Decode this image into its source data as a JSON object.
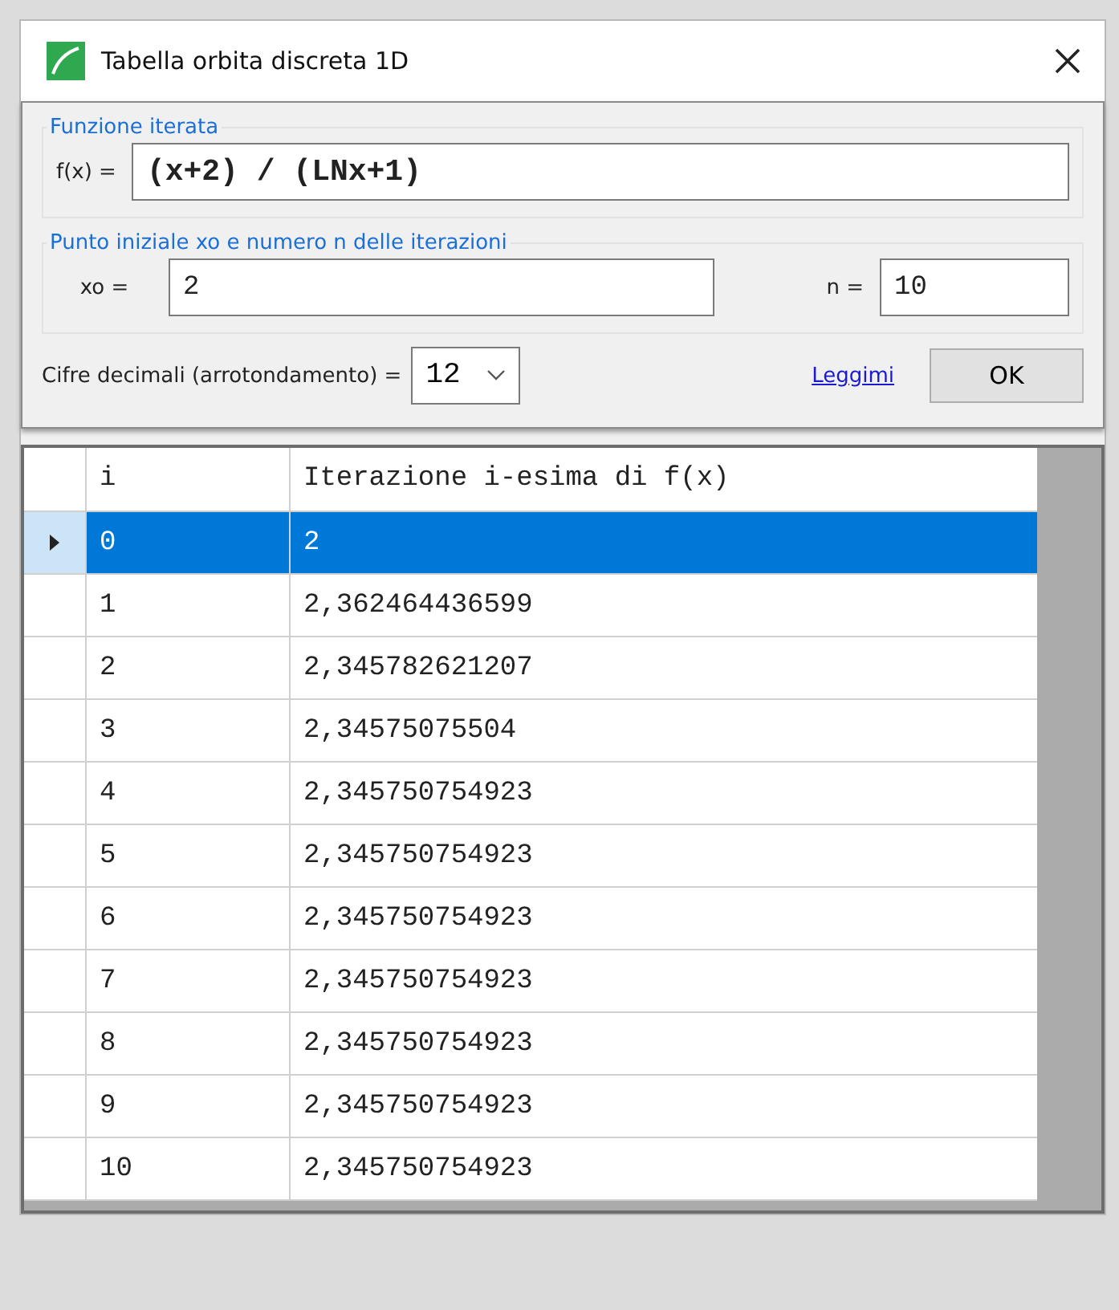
{
  "window": {
    "title": "Tabella orbita discreta 1D"
  },
  "function_group": {
    "legend": "Funzione iterata",
    "label": "f(x) =",
    "value": "(x+2) / (LNx+1)"
  },
  "start_group": {
    "legend": "Punto iniziale xo e numero n delle iterazioni",
    "xo_label": "xo =",
    "xo_value": "2",
    "n_label": "n =",
    "n_value": "10"
  },
  "decimals": {
    "label": "Cifre decimali (arrotondamento) =",
    "value": "12"
  },
  "readme_link": "Leggimi",
  "ok_button": "OK",
  "table": {
    "columns": [
      "i",
      "Iterazione i-esima di f(x)"
    ],
    "rows": [
      {
        "i": "0",
        "value": "2",
        "selected": true
      },
      {
        "i": "1",
        "value": "2,362464436599",
        "selected": false
      },
      {
        "i": "2",
        "value": "2,345782621207",
        "selected": false
      },
      {
        "i": "3",
        "value": "2,34575075504",
        "selected": false
      },
      {
        "i": "4",
        "value": "2,345750754923",
        "selected": false
      },
      {
        "i": "5",
        "value": "2,345750754923",
        "selected": false
      },
      {
        "i": "6",
        "value": "2,345750754923",
        "selected": false
      },
      {
        "i": "7",
        "value": "2,345750754923",
        "selected": false
      },
      {
        "i": "8",
        "value": "2,345750754923",
        "selected": false
      },
      {
        "i": "9",
        "value": "2,345750754923",
        "selected": false
      },
      {
        "i": "10",
        "value": "2,345750754923",
        "selected": false
      }
    ]
  }
}
